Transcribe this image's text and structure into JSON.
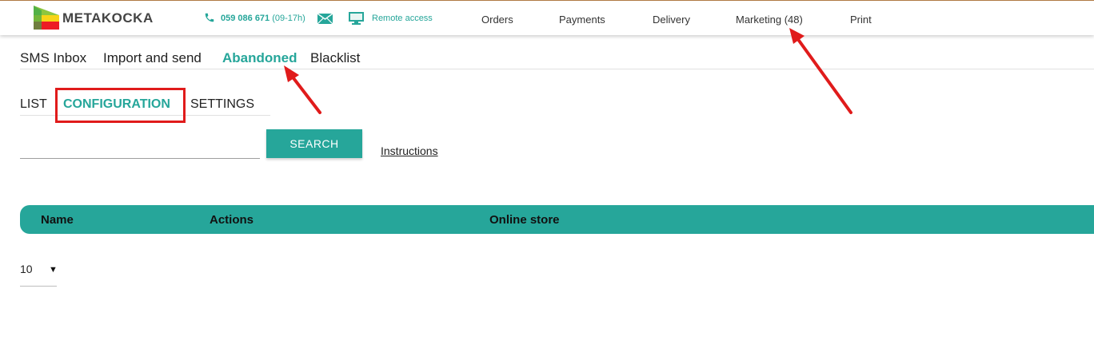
{
  "header": {
    "brand": "METAKOCKA",
    "phone_number": "059 086 671",
    "phone_hours": "(09-17h)",
    "remote_access": "Remote access",
    "nav": [
      {
        "label": "Orders"
      },
      {
        "label": "Payments"
      },
      {
        "label": "Delivery"
      },
      {
        "label": "Marketing (48)"
      },
      {
        "label": "Print"
      }
    ]
  },
  "subnav": [
    {
      "label": "SMS Inbox"
    },
    {
      "label": "Import and send"
    },
    {
      "label": "Abandoned"
    },
    {
      "label": "Blacklist"
    }
  ],
  "tabs": [
    {
      "label": "LIST"
    },
    {
      "label": "CONFIGURATION"
    },
    {
      "label": "SETTINGS"
    }
  ],
  "search": {
    "value": "",
    "placeholder": "",
    "button_label": "SEARCH",
    "instructions_label": "Instructions"
  },
  "table": {
    "columns": [
      "Name",
      "Actions",
      "Online store"
    ]
  },
  "pagination": {
    "page_size": "10"
  },
  "colors": {
    "accent": "#26a69a",
    "annotation": "#e01b1b"
  },
  "icons": [
    "logo-icon",
    "phone-icon",
    "mail-icon",
    "monitor-icon",
    "dropdown-arrow-icon"
  ]
}
